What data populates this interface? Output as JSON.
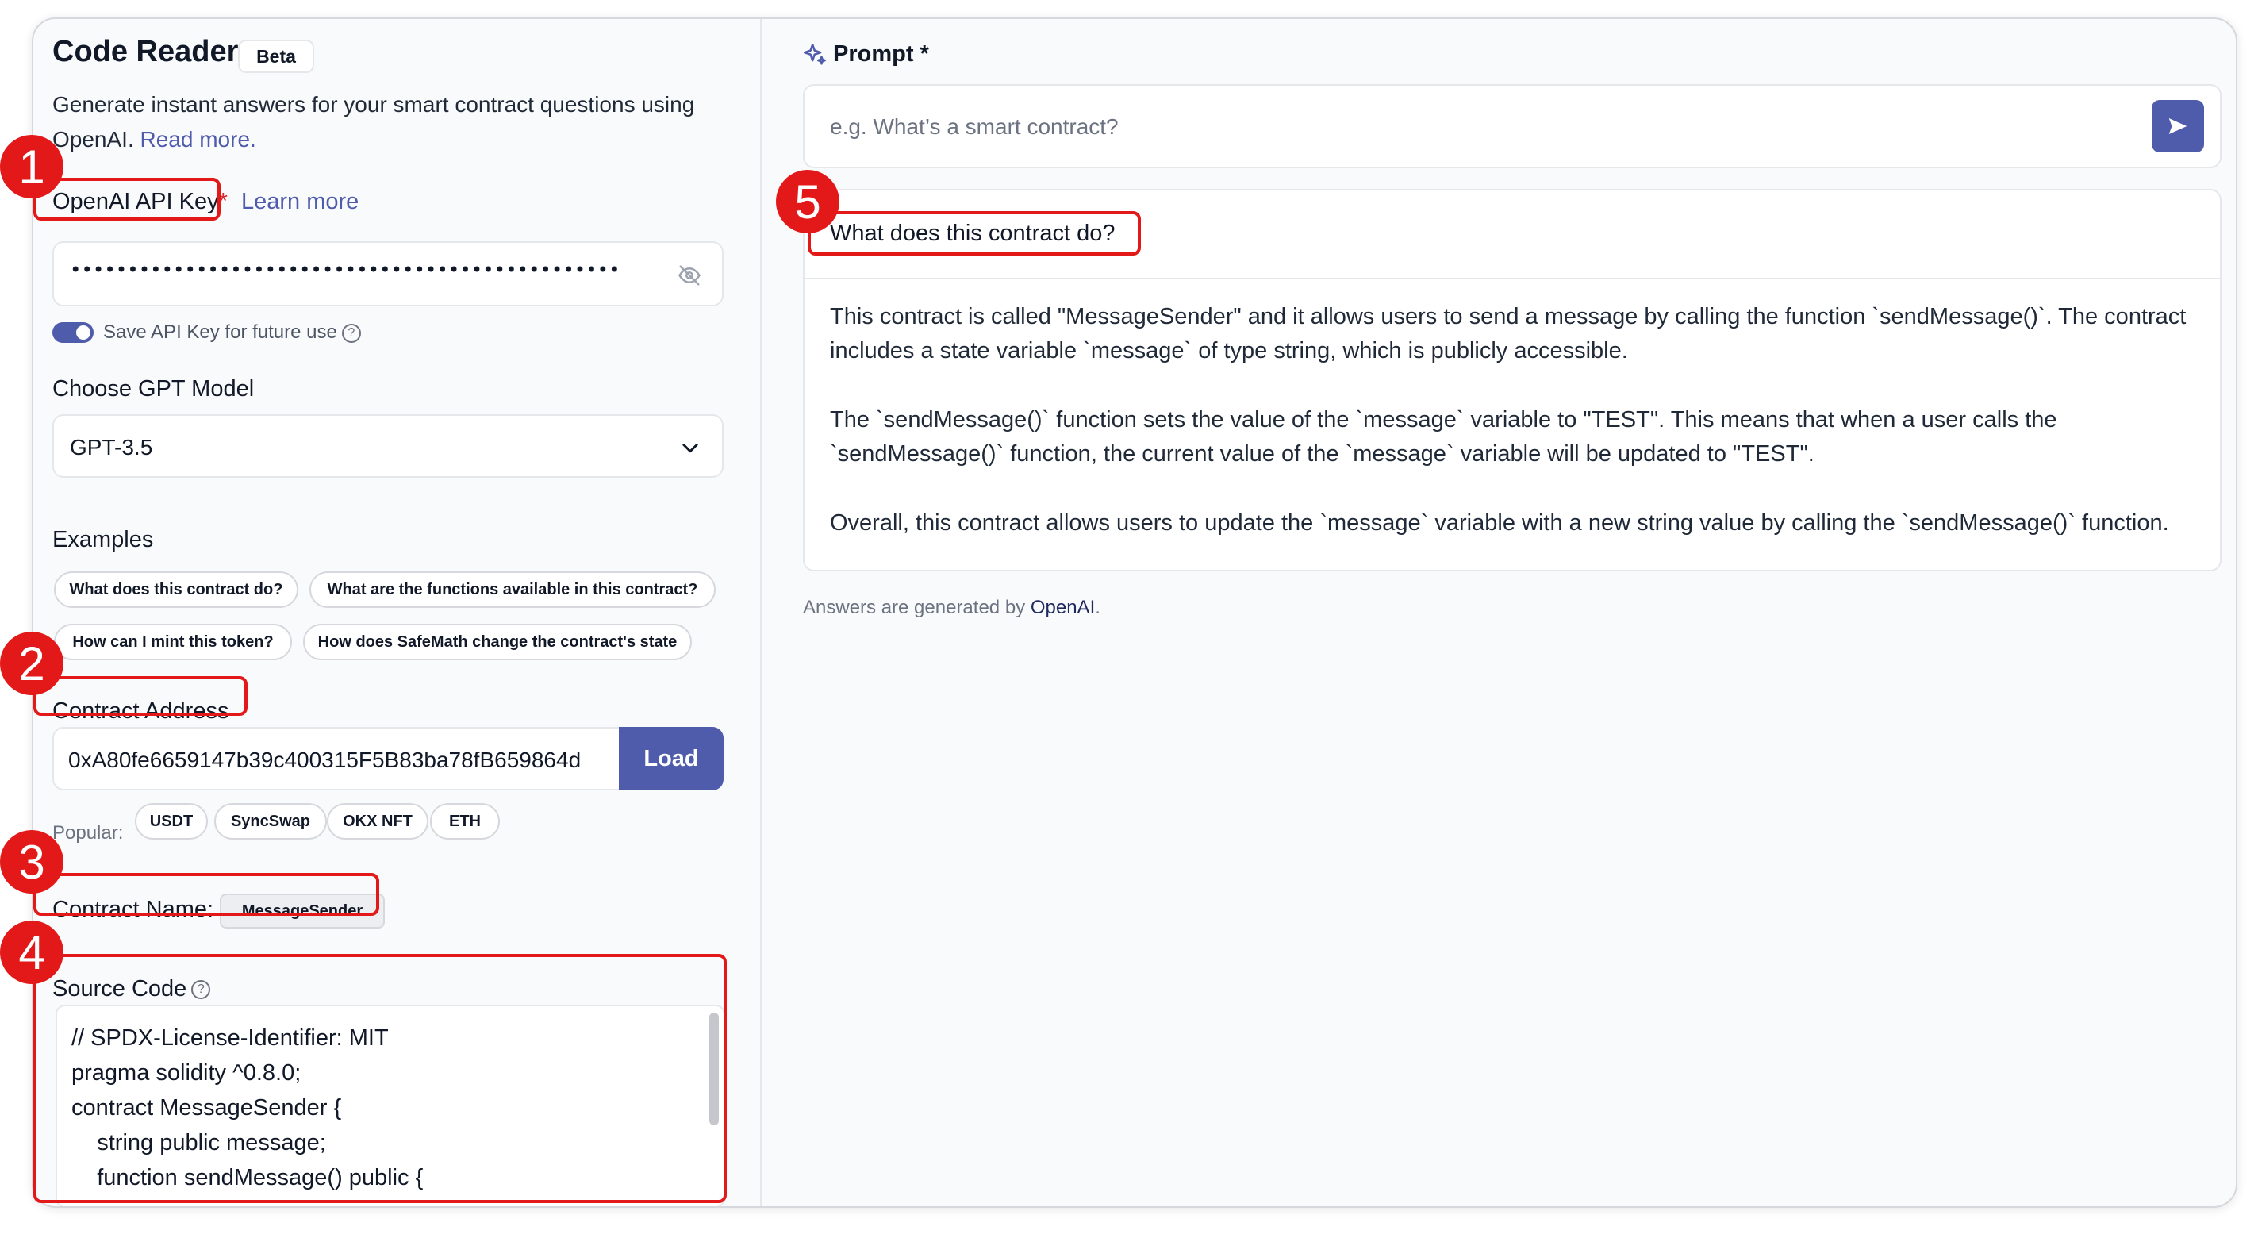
{
  "left": {
    "title": "Code Reader",
    "badge": "Beta",
    "intro_text": "Generate instant answers for your smart contract questions using OpenAI.",
    "intro_link": "Read more.",
    "api_key_label": "OpenAI API Key",
    "required_mark": "*",
    "learn_more": "Learn more",
    "api_key_value": "••••••••••••••••••••••••••••••••••••••••••••••••",
    "save_key_label": "Save API Key for future use",
    "help_glyph": "?",
    "model_label": "Choose GPT Model",
    "model_value": "GPT-3.5",
    "examples_label": "Examples",
    "examples": [
      "What does this contract do?",
      "What are the functions available in this contract?",
      "How can I mint this token?",
      "How does SafeMath change the contract's state"
    ],
    "contract_address_label": "Contract Address",
    "contract_address_value": "0xA80fe6659147b39c400315F5B83ba78fB659864d",
    "load_button": "Load",
    "popular_label": "Popular:",
    "popular": [
      "USDT",
      "SyncSwap",
      "OKX NFT",
      "ETH"
    ],
    "contract_name_label": "Contract Name:",
    "contract_name_value": "MessageSender",
    "source_code_label": "Source Code",
    "source_code_lines": [
      "// SPDX-License-Identifier: MIT",
      "pragma solidity ^0.8.0;",
      "contract MessageSender {",
      "    string public message;",
      "    function sendMessage() public {"
    ]
  },
  "right": {
    "prompt_label": "Prompt *",
    "prompt_placeholder": "e.g. What’s a smart contract?",
    "question": "What does this contract do?",
    "answer_paragraphs": [
      "This contract is called \"MessageSender\" and it allows users to send a message by calling the function `sendMessage()`. The contract includes a state variable `message` of type string, which is publicly accessible.",
      "The `sendMessage()` function sets the value of the `message` variable to \"TEST\". This means that when a user calls the `sendMessage()` function, the current value of the `message` variable will be updated to \"TEST\".",
      "Overall, this contract allows users to update the `message` variable with a new string value by calling the `sendMessage()` function."
    ],
    "footer_text": "Answers are generated by",
    "footer_link": "OpenAI",
    "footer_end": "."
  },
  "annotations": [
    "1",
    "2",
    "3",
    "4",
    "5"
  ],
  "colors": {
    "accent": "#4f5bab",
    "annotation": "#e31919"
  },
  "icons": [
    "eye-off-icon",
    "help-icon",
    "chevron-down-icon",
    "sparkle-icon",
    "send-icon"
  ]
}
